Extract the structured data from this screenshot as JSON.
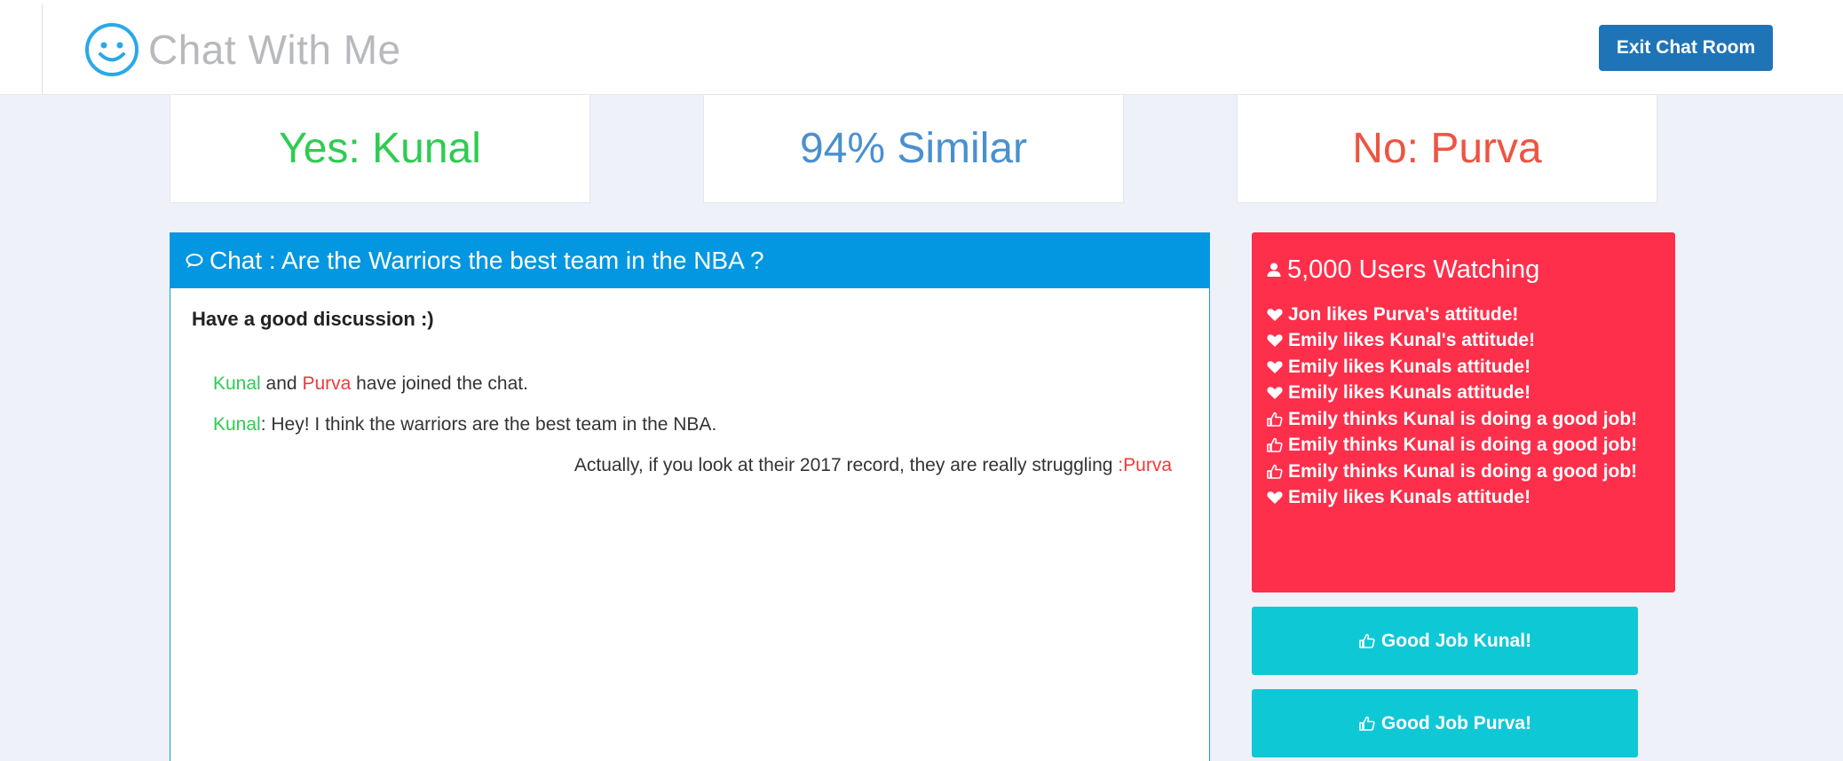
{
  "navbar": {
    "brand_text": "Chat With Me",
    "brand_icon": "smiley-icon",
    "exit_label": "Exit Chat Room"
  },
  "stats": {
    "yes": "Yes: Kunal",
    "similarity": "94% Similar",
    "no": "No: Purva"
  },
  "chat": {
    "header_title": "Chat : Are the Warriors the best team in the NBA ?",
    "intro": "Have a good discussion :)",
    "joined": {
      "name1": "Kunal",
      "connector": " and ",
      "name2": "Purva",
      "suffix": " have joined the chat."
    },
    "message_kunal": {
      "name": "Kunal",
      "sep": ": ",
      "text": "Hey! I think the warriors are the best team in the NBA."
    },
    "message_purva": {
      "text": "Actually, if you look at their 2017 record, they are really struggling ",
      "sep": ":",
      "name": "Purva"
    }
  },
  "watchers": {
    "title": "5,000 Users Watching",
    "activity": [
      {
        "icon": "heart-icon",
        "text": "Jon likes Purva's attitude!"
      },
      {
        "icon": "heart-icon",
        "text": "Emily likes Kunal's attitude!"
      },
      {
        "icon": "heart-icon",
        "text": "Emily likes Kunals attitude!"
      },
      {
        "icon": "heart-icon",
        "text": "Emily likes Kunals attitude!"
      },
      {
        "icon": "thumbs-up-icon",
        "text": "Emily thinks Kunal is doing a good job!"
      },
      {
        "icon": "thumbs-up-icon",
        "text": "Emily thinks Kunal is doing a good job!"
      },
      {
        "icon": "thumbs-up-icon",
        "text": "Emily thinks Kunal is doing a good job!"
      },
      {
        "icon": "heart-icon",
        "text": "Emily likes Kunals attitude!"
      }
    ]
  },
  "buttons": {
    "good_job_kunal": "Good Job Kunal!",
    "good_job_purva": "Good Job Purva!"
  },
  "colors": {
    "navbar_button": "#1f74b8",
    "yes_green": "#2ecc52",
    "similar_blue": "#4a90cf",
    "no_red": "#ee5442",
    "chat_header": "#0397e2",
    "watch_panel": "#fd2f4b",
    "good_job_button": "#0ec8d6"
  }
}
